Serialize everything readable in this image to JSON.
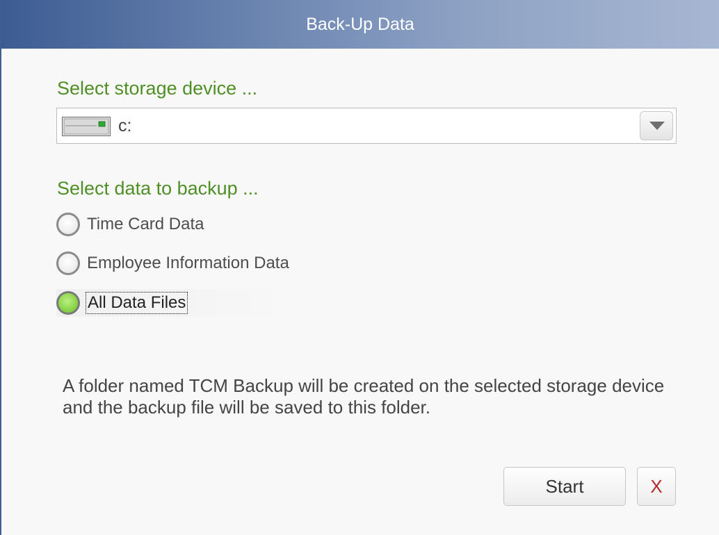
{
  "window": {
    "title": "Back-Up Data"
  },
  "storage": {
    "label": "Select storage device ...",
    "selected_value": "c:",
    "icon": "drive-icon"
  },
  "backup_data": {
    "label": "Select data to backup ...",
    "options": [
      {
        "label": "Time Card Data",
        "checked": false
      },
      {
        "label": "Employee Information Data",
        "checked": false
      },
      {
        "label": "All Data Files",
        "checked": true
      }
    ]
  },
  "info": {
    "text": "A folder named TCM Backup will be created on the selected storage device and the backup file will be saved to this folder."
  },
  "buttons": {
    "start_label": "Start",
    "close_label": "X"
  },
  "colors": {
    "title_gradient_start": "#3d5c92",
    "title_gradient_end": "#a7b7d2",
    "section_label": "#4f8f26",
    "radio_checked": "#8ed64c",
    "close_x": "#b22a2a"
  }
}
